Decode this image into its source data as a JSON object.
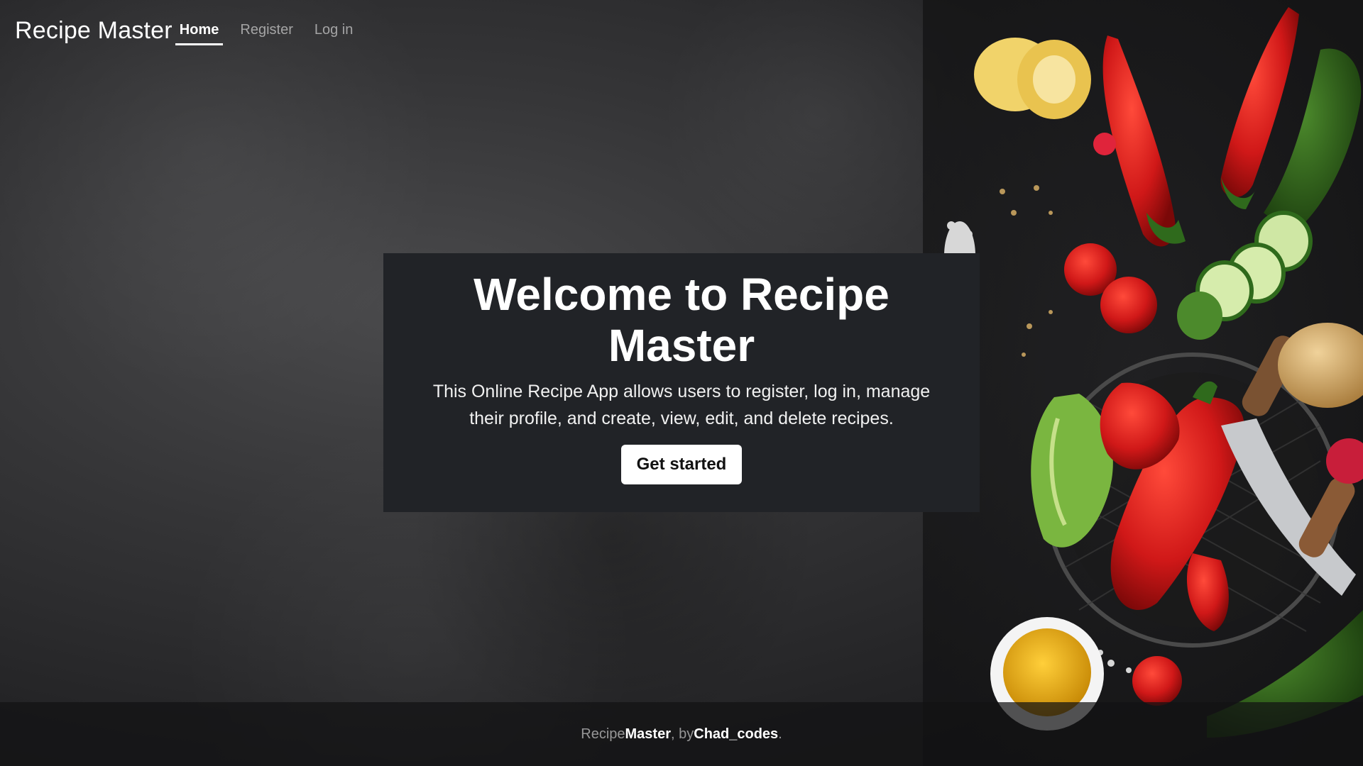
{
  "nav": {
    "brand": "Recipe Master",
    "links": [
      {
        "label": "Home",
        "active": true
      },
      {
        "label": "Register",
        "active": false
      },
      {
        "label": "Log in",
        "active": false
      }
    ]
  },
  "hero": {
    "title": "Welcome to Recipe Master",
    "description": "This Online Recipe App allows users to register, log in, manage their profile, and create, view, edit, and delete recipes.",
    "cta_label": "Get started"
  },
  "footer": {
    "prefix": "Recipe ",
    "brand": "Master",
    "by": ", by ",
    "author": "Chad_codes",
    "suffix": "."
  },
  "colors": {
    "hero_box": "#212327",
    "background": "#353537",
    "cta_bg": "#ffffff",
    "pepper_red": "#d01818",
    "zucchini_green": "#2f6a1c",
    "oil_yellow": "#e8a614"
  },
  "icons": {
    "background_image": "vegetables-image"
  }
}
